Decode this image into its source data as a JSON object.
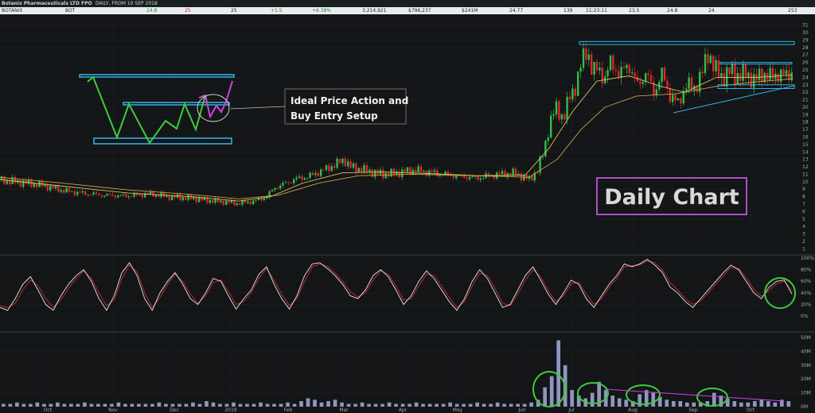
{
  "header": {
    "title": "Botanix Pharmaceuticals LTD FPO",
    "subtitle": "DAILY, FROM 10 SEP 2018",
    "quote": [
      {
        "key": "ticker",
        "text": "BOTANIX"
      },
      {
        "key": "code",
        "text": "BOT"
      },
      {
        "key": "bid",
        "text": "24.8"
      },
      {
        "key": "bid_qty",
        "text": "25"
      },
      {
        "key": "ask_qty",
        "text": "25"
      },
      {
        "key": "change",
        "text": "+1.5"
      },
      {
        "key": "change_pct",
        "text": "+6.38%"
      },
      {
        "key": "volume",
        "text": "3,214,921"
      },
      {
        "key": "value",
        "text": "$796,237"
      },
      {
        "key": "mcap",
        "text": "$241M"
      },
      {
        "key": "vwap",
        "text": "24.77"
      },
      {
        "key": "trades",
        "text": "139"
      },
      {
        "key": "time",
        "text": "11:23:11"
      },
      {
        "key": "open",
        "text": "23.5"
      },
      {
        "key": "high",
        "text": "24.8"
      },
      {
        "key": "low",
        "text": "24"
      },
      {
        "key": "last",
        "text": "253"
      }
    ]
  },
  "annotations": {
    "setup_line1": "Ideal Price Action and",
    "setup_line2": "Buy Entry Setup",
    "daily_chart": "Daily Chart"
  },
  "colors": {
    "background": "#131517",
    "up_candle": "#2fbf4a",
    "down_candle": "#e0232b",
    "ma_fast": "#d9c05a",
    "ma_slow": "#c8a04a",
    "stoch_k": "#e8e8e8",
    "stoch_d": "#d42a2a",
    "volume_bar": "#8f96c0",
    "zone_line": "#35b3e8",
    "highlight_circle": "#3ccc3c",
    "magenta": "#cc44dd",
    "label_border": "#b050c8"
  },
  "chart_data": [
    {
      "type": "candlestick",
      "title": "",
      "x_tick_labels": [
        "Oct",
        "Nov",
        "Dec",
        "2019",
        "Feb",
        "Mar",
        "Apr",
        "May",
        "Jun",
        "Jul",
        "Aug",
        "Sep",
        "Oct"
      ],
      "ylim": [
        0,
        31
      ],
      "y_tick_labels": [
        "1",
        "2",
        "3",
        "4",
        "5",
        "6",
        "7",
        "8",
        "9",
        "10",
        "11",
        "12",
        "13",
        "14",
        "15",
        "16",
        "17",
        "18",
        "19",
        "20",
        "21",
        "22",
        "23",
        "24",
        "25",
        "26",
        "27",
        "28",
        "29",
        "30",
        "31"
      ],
      "close_path": [
        {
          "x": 0,
          "y": 10.2
        },
        {
          "x": 20,
          "y": 10.0
        },
        {
          "x": 50,
          "y": 9.6
        },
        {
          "x": 80,
          "y": 8.8
        },
        {
          "x": 100,
          "y": 8.5
        },
        {
          "x": 130,
          "y": 8.2
        },
        {
          "x": 160,
          "y": 8.1
        },
        {
          "x": 190,
          "y": 8.4
        },
        {
          "x": 210,
          "y": 8.0
        },
        {
          "x": 240,
          "y": 7.8
        },
        {
          "x": 270,
          "y": 7.4
        },
        {
          "x": 300,
          "y": 7.1
        },
        {
          "x": 320,
          "y": 7.4
        },
        {
          "x": 335,
          "y": 8.0
        },
        {
          "x": 345,
          "y": 9.2
        },
        {
          "x": 355,
          "y": 9.6
        },
        {
          "x": 370,
          "y": 10.3
        },
        {
          "x": 390,
          "y": 10.8
        },
        {
          "x": 405,
          "y": 11.5
        },
        {
          "x": 420,
          "y": 12.2
        },
        {
          "x": 432,
          "y": 13.0
        },
        {
          "x": 440,
          "y": 12.0
        },
        {
          "x": 460,
          "y": 11.5
        },
        {
          "x": 480,
          "y": 11.0
        },
        {
          "x": 500,
          "y": 11.2
        },
        {
          "x": 520,
          "y": 11.6
        },
        {
          "x": 545,
          "y": 11.2
        },
        {
          "x": 570,
          "y": 10.8
        },
        {
          "x": 600,
          "y": 10.5
        },
        {
          "x": 625,
          "y": 11.0
        },
        {
          "x": 645,
          "y": 11.2
        },
        {
          "x": 665,
          "y": 10.3
        },
        {
          "x": 675,
          "y": 11.5
        },
        {
          "x": 683,
          "y": 14.0
        },
        {
          "x": 690,
          "y": 17.5
        },
        {
          "x": 698,
          "y": 20.0
        },
        {
          "x": 708,
          "y": 18.5
        },
        {
          "x": 716,
          "y": 21.5
        },
        {
          "x": 724,
          "y": 23.0
        },
        {
          "x": 732,
          "y": 26.5
        },
        {
          "x": 738,
          "y": 28.0
        },
        {
          "x": 744,
          "y": 24.5
        },
        {
          "x": 752,
          "y": 25.5
        },
        {
          "x": 760,
          "y": 23.5
        },
        {
          "x": 768,
          "y": 26.5
        },
        {
          "x": 778,
          "y": 24.0
        },
        {
          "x": 788,
          "y": 26.0
        },
        {
          "x": 800,
          "y": 23.0
        },
        {
          "x": 812,
          "y": 24.5
        },
        {
          "x": 822,
          "y": 22.0
        },
        {
          "x": 832,
          "y": 24.5
        },
        {
          "x": 842,
          "y": 21.5
        },
        {
          "x": 852,
          "y": 20.5
        },
        {
          "x": 862,
          "y": 23.0
        },
        {
          "x": 872,
          "y": 22.5
        },
        {
          "x": 882,
          "y": 24.5
        },
        {
          "x": 890,
          "y": 27.5
        },
        {
          "x": 898,
          "y": 25.0
        },
        {
          "x": 908,
          "y": 24.0
        },
        {
          "x": 918,
          "y": 24.8
        },
        {
          "x": 928,
          "y": 24.2
        },
        {
          "x": 938,
          "y": 24.5
        },
        {
          "x": 948,
          "y": 23.5
        },
        {
          "x": 958,
          "y": 24.6
        },
        {
          "x": 968,
          "y": 24.0
        },
        {
          "x": 978,
          "y": 24.5
        },
        {
          "x": 988,
          "y": 24.2
        },
        {
          "x": 995,
          "y": 24.8
        }
      ],
      "ma_fast_path": [
        {
          "x": 0,
          "y": 10.3
        },
        {
          "x": 80,
          "y": 9.4
        },
        {
          "x": 160,
          "y": 8.5
        },
        {
          "x": 240,
          "y": 8.0
        },
        {
          "x": 300,
          "y": 7.4
        },
        {
          "x": 340,
          "y": 8.0
        },
        {
          "x": 380,
          "y": 9.8
        },
        {
          "x": 430,
          "y": 11.2
        },
        {
          "x": 480,
          "y": 11.3
        },
        {
          "x": 540,
          "y": 11.1
        },
        {
          "x": 600,
          "y": 10.8
        },
        {
          "x": 660,
          "y": 10.9
        },
        {
          "x": 690,
          "y": 14.5
        },
        {
          "x": 720,
          "y": 19.5
        },
        {
          "x": 750,
          "y": 23.5
        },
        {
          "x": 790,
          "y": 24.2
        },
        {
          "x": 830,
          "y": 22.8
        },
        {
          "x": 860,
          "y": 22.0
        },
        {
          "x": 900,
          "y": 24.0
        },
        {
          "x": 950,
          "y": 24.0
        },
        {
          "x": 995,
          "y": 24.3
        }
      ],
      "ma_slow_path": [
        {
          "x": 0,
          "y": 10.6
        },
        {
          "x": 80,
          "y": 9.8
        },
        {
          "x": 160,
          "y": 8.9
        },
        {
          "x": 240,
          "y": 8.3
        },
        {
          "x": 300,
          "y": 7.7
        },
        {
          "x": 350,
          "y": 8.2
        },
        {
          "x": 400,
          "y": 9.8
        },
        {
          "x": 450,
          "y": 10.8
        },
        {
          "x": 520,
          "y": 11.0
        },
        {
          "x": 600,
          "y": 10.8
        },
        {
          "x": 665,
          "y": 10.6
        },
        {
          "x": 700,
          "y": 13.0
        },
        {
          "x": 730,
          "y": 17.0
        },
        {
          "x": 760,
          "y": 20.0
        },
        {
          "x": 800,
          "y": 21.5
        },
        {
          "x": 850,
          "y": 21.8
        },
        {
          "x": 900,
          "y": 22.8
        },
        {
          "x": 950,
          "y": 23.4
        },
        {
          "x": 995,
          "y": 23.8
        }
      ],
      "zones": [
        {
          "y1": 28.8,
          "y2": 28.4,
          "x1": 728,
          "x2": 998
        },
        {
          "y1": 26.0,
          "y2": 26.0,
          "x1": 905,
          "x2": 995
        },
        {
          "y1": 23.0,
          "y2": 22.5,
          "x1": 902,
          "x2": 998
        }
      ]
    },
    {
      "type": "line",
      "title": "",
      "ylim": [
        0,
        100
      ],
      "y_tick_labels": [
        "0%",
        "20%",
        "40%",
        "60%",
        "80%",
        "100%"
      ],
      "series": [
        {
          "values": [
            15,
            10,
            30,
            55,
            68,
            45,
            20,
            10,
            35,
            55,
            70,
            80,
            60,
            30,
            10,
            35,
            75,
            92,
            70,
            30,
            10,
            40,
            60,
            75,
            55,
            30,
            20,
            40,
            65,
            60,
            35,
            12,
            30,
            45,
            72,
            85,
            55,
            30,
            12,
            35,
            70,
            90,
            92,
            82,
            70,
            55,
            35,
            30,
            45,
            70,
            80,
            68,
            45,
            20,
            35,
            60,
            78,
            65,
            45,
            25,
            10,
            30,
            60,
            80,
            65,
            40,
            15,
            20,
            45,
            70,
            85,
            62,
            38,
            20,
            40,
            62,
            55,
            30,
            15,
            35,
            55,
            70,
            90,
            85,
            90,
            98,
            88,
            75,
            50,
            40,
            25,
            15,
            30,
            45,
            60,
            75,
            88,
            80,
            60,
            40,
            30,
            50,
            60,
            62,
            38
          ]
        },
        {
          "values": [
            18,
            15,
            22,
            45,
            62,
            52,
            30,
            15,
            28,
            48,
            65,
            78,
            65,
            40,
            18,
            28,
            65,
            88,
            76,
            40,
            15,
            32,
            55,
            72,
            60,
            38,
            22,
            35,
            58,
            62,
            42,
            20,
            25,
            40,
            65,
            82,
            62,
            38,
            18,
            30,
            60,
            85,
            90,
            86,
            74,
            60,
            42,
            33,
            40,
            62,
            78,
            72,
            52,
            28,
            30,
            52,
            72,
            70,
            52,
            32,
            15,
            25,
            52,
            74,
            70,
            48,
            22,
            18,
            38,
            62,
            80,
            68,
            44,
            25,
            35,
            56,
            58,
            38,
            20,
            30,
            50,
            65,
            85,
            87,
            88,
            95,
            92,
            80,
            58,
            45,
            30,
            20,
            26,
            40,
            55,
            70,
            84,
            82,
            66,
            46,
            34,
            44,
            56,
            60,
            44
          ]
        }
      ]
    },
    {
      "type": "bar",
      "title": "",
      "ylim": [
        0,
        50
      ],
      "y_tick_labels": [
        "0M",
        "10M",
        "20M",
        "30M",
        "40M",
        "50M"
      ],
      "values": [
        2,
        2,
        3,
        2,
        2,
        3,
        2,
        2,
        3,
        2,
        2,
        2,
        3,
        2,
        2,
        2,
        2,
        3,
        2,
        2,
        2,
        2,
        2,
        3,
        2,
        2,
        2,
        2,
        3,
        2,
        4,
        3,
        2,
        2,
        3,
        2,
        2,
        2,
        3,
        2,
        2,
        2,
        3,
        2,
        4,
        6,
        5,
        3,
        4,
        5,
        3,
        2,
        2,
        3,
        2,
        2,
        2,
        3,
        2,
        2,
        2,
        3,
        2,
        2,
        2,
        2,
        3,
        2,
        2,
        2,
        3,
        2,
        2,
        3,
        2,
        2,
        2,
        2,
        3,
        5,
        14,
        22,
        48,
        30,
        12,
        8,
        6,
        10,
        18,
        12,
        8,
        6,
        5,
        4,
        9,
        12,
        10,
        7,
        5,
        4,
        4,
        3,
        3,
        3,
        4,
        10,
        8,
        6,
        4,
        3,
        3,
        4,
        5,
        4,
        3,
        5,
        4
      ]
    }
  ]
}
